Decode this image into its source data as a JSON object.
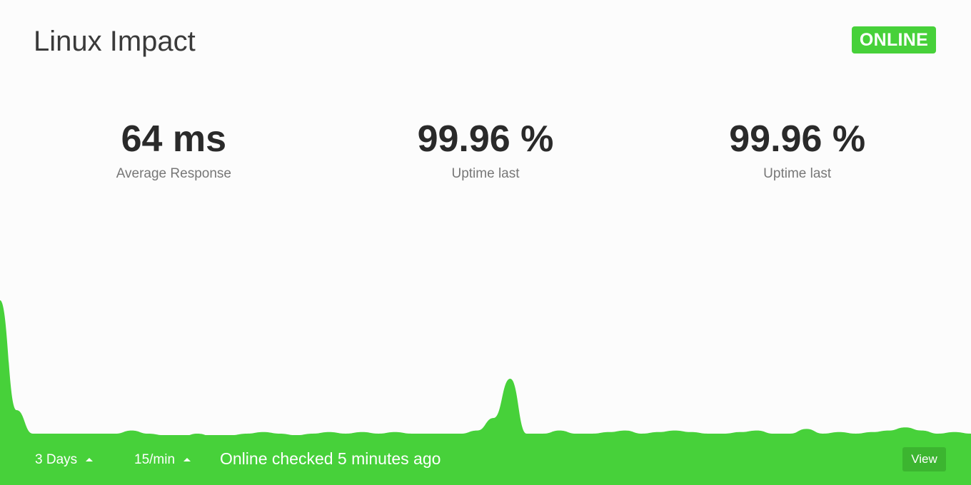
{
  "header": {
    "title": "Linux Impact",
    "status_badge": "ONLINE"
  },
  "stats": [
    {
      "value": "64 ms",
      "label": "Average Response"
    },
    {
      "value": "99.96 %",
      "label": "Uptime last"
    },
    {
      "value": "99.96 %",
      "label": "Uptime last"
    }
  ],
  "footer": {
    "range_label": "3 Days",
    "interval_label": "15/min",
    "status_text": "Online checked 5 minutes ago",
    "view_label": "View"
  },
  "colors": {
    "accent": "#47d13a",
    "accent_dark": "#3cb530",
    "text_dark": "#2a2a2a",
    "text_muted": "#777777"
  },
  "chart_data": {
    "type": "area",
    "series": [
      {
        "values": [
          0.95,
          0.25,
          0.1,
          0.1,
          0.1,
          0.1,
          0.1,
          0.1,
          0.12,
          0.1,
          0.09,
          0.08,
          0.1,
          0.08,
          0.09,
          0.1,
          0.11,
          0.1,
          0.09,
          0.1,
          0.11,
          0.1,
          0.11,
          0.1,
          0.11,
          0.1,
          0.1,
          0.1,
          0.1,
          0.12,
          0.2,
          0.45,
          0.1,
          0.1,
          0.12,
          0.1,
          0.1,
          0.11,
          0.12,
          0.1,
          0.11,
          0.12,
          0.11,
          0.1,
          0.1,
          0.11,
          0.12,
          0.1,
          0.1,
          0.13,
          0.1,
          0.11,
          0.1,
          0.11,
          0.12,
          0.14,
          0.12,
          0.1,
          0.11,
          0.1
        ]
      }
    ]
  }
}
